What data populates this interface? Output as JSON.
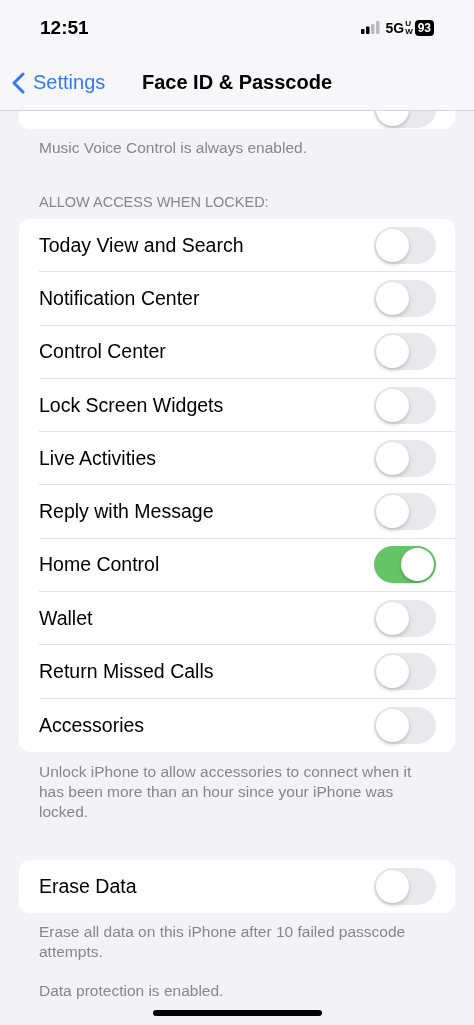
{
  "status_bar": {
    "time": "12:51",
    "network": "5G",
    "network_badge": "UW",
    "battery": "93"
  },
  "nav": {
    "back": "Settings",
    "title": "Face ID & Passcode"
  },
  "top_group": {
    "toggle_on": false,
    "footer": "Music Voice Control is always enabled."
  },
  "locked_section": {
    "header": "ALLOW ACCESS WHEN LOCKED:",
    "items": [
      {
        "label": "Today View and Search",
        "on": false
      },
      {
        "label": "Notification Center",
        "on": false
      },
      {
        "label": "Control Center",
        "on": false
      },
      {
        "label": "Lock Screen Widgets",
        "on": false
      },
      {
        "label": "Live Activities",
        "on": false
      },
      {
        "label": "Reply with Message",
        "on": false
      },
      {
        "label": "Home Control",
        "on": true
      },
      {
        "label": "Wallet",
        "on": false
      },
      {
        "label": "Return Missed Calls",
        "on": false
      },
      {
        "label": "Accessories",
        "on": false
      }
    ],
    "footer": "Unlock iPhone to allow accessories to connect when it has been more than an hour since your iPhone was locked."
  },
  "erase_section": {
    "items": [
      {
        "label": "Erase Data",
        "on": false
      }
    ],
    "footers": [
      "Erase all data on this iPhone after 10 failed passcode attempts.",
      "Data protection is enabled."
    ]
  }
}
